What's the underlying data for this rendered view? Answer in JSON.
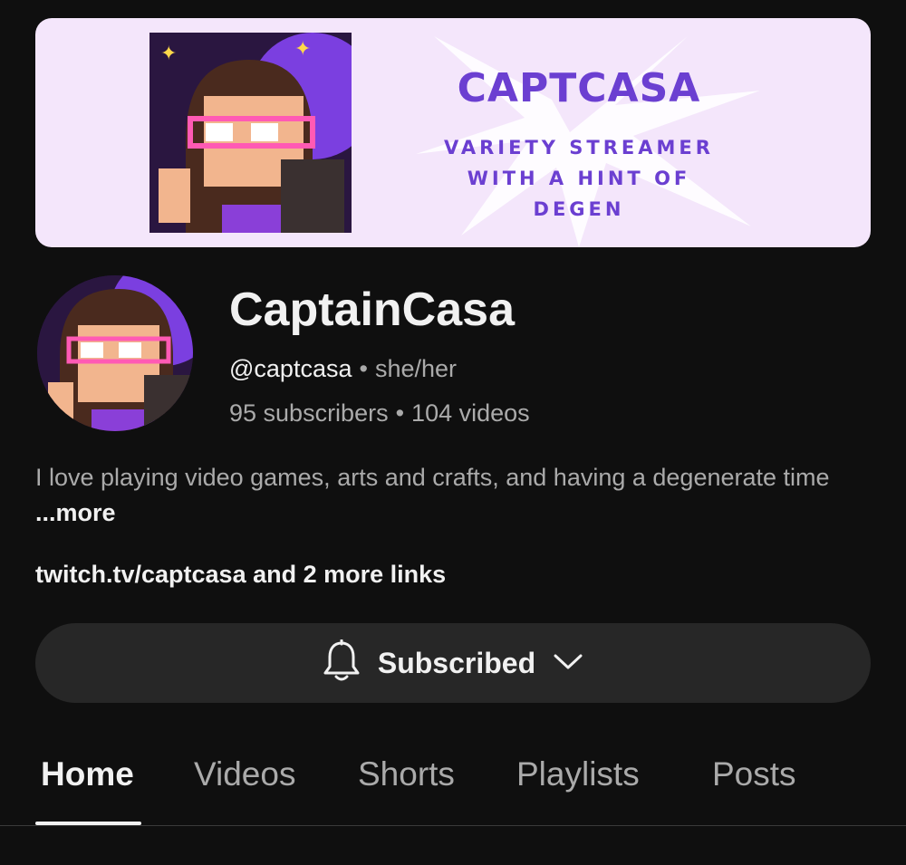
{
  "banner": {
    "title": "CAPTCASA",
    "subtitle_line1": "VARIETY STREAMER",
    "subtitle_line2": "WITH A HINT OF",
    "subtitle_line3": "DEGEN"
  },
  "channel": {
    "name": "CaptainCasa",
    "handle": "@captcasa",
    "pronouns": "she/her",
    "subscribers": "95 subscribers",
    "videos": "104 videos",
    "separator": "•"
  },
  "description": {
    "text": "I love playing video games, arts and crafts, and having a degenerate time ",
    "more": "...more"
  },
  "links": {
    "main": "twitch.tv/captcasa",
    "extra": " and 2 more links"
  },
  "subscribe": {
    "label": "Subscribed",
    "icon": "bell-icon"
  },
  "tabs": [
    {
      "label": "Home",
      "active": true
    },
    {
      "label": "Videos"
    },
    {
      "label": "Shorts"
    },
    {
      "label": "Playlists"
    },
    {
      "label": "Posts"
    }
  ],
  "colors": {
    "background": "#0f0f0f",
    "banner_bg": "#f4e6fb",
    "banner_text": "#6b3fd1",
    "button_bg": "#272727",
    "secondary_text": "#aaaaaa"
  }
}
